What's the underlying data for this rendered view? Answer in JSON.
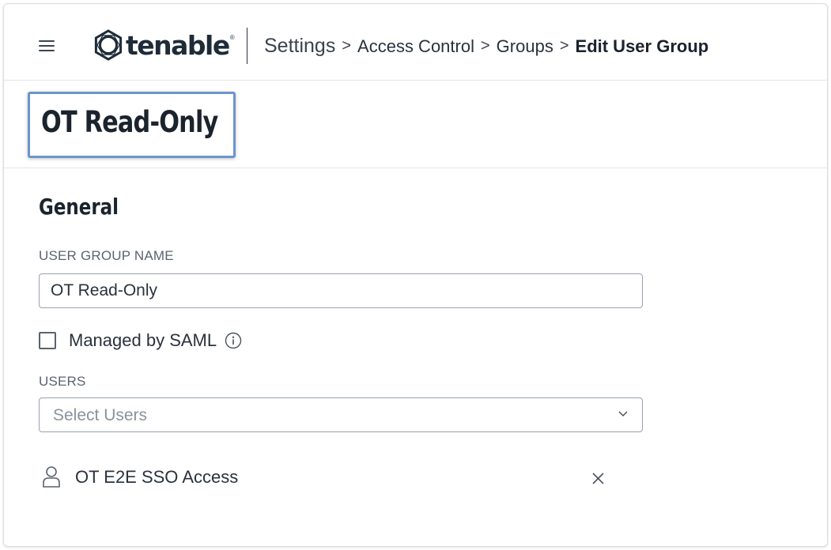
{
  "header": {
    "menu_icon": "hamburger-menu-icon",
    "logo_text": "tenable",
    "logo_trademark": "®",
    "breadcrumb": {
      "items": [
        "Settings",
        "Access Control",
        "Groups"
      ],
      "current": "Edit User Group",
      "separator": ">"
    }
  },
  "page": {
    "title": "OT Read-Only",
    "highlight_color": "#6b94cf"
  },
  "general": {
    "section_title": "General",
    "group_name_label": "USER GROUP NAME",
    "group_name_value": "OT Read-Only",
    "saml_checkbox_label": "Managed by SAML",
    "saml_checked": false,
    "info_icon": "info-circle-icon",
    "users_label": "USERS",
    "users_placeholder": "Select Users",
    "dropdown_icon": "chevron-down-icon",
    "users": [
      {
        "name": "OT E2E SSO Access",
        "icon": "user-icon",
        "remove_icon": "close-icon"
      }
    ]
  }
}
